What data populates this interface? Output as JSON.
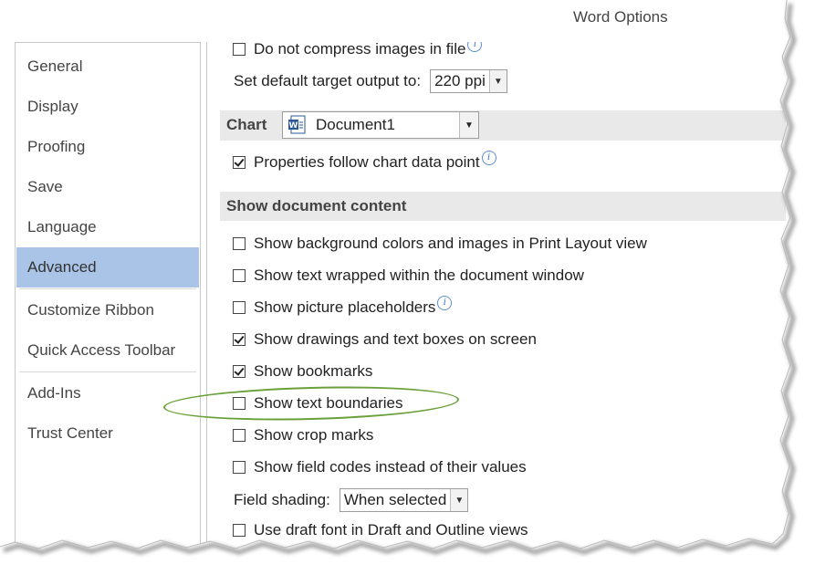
{
  "window": {
    "title": "Word Options"
  },
  "sidebar": {
    "items": [
      {
        "label": "General",
        "active": false
      },
      {
        "label": "Display",
        "active": false
      },
      {
        "label": "Proofing",
        "active": false
      },
      {
        "label": "Save",
        "active": false
      },
      {
        "label": "Language",
        "active": false
      },
      {
        "label": "Advanced",
        "active": true
      },
      {
        "label": "Customize Ribbon",
        "active": false
      },
      {
        "label": "Quick Access Toolbar",
        "active": false
      },
      {
        "label": "Add-Ins",
        "active": false
      },
      {
        "label": "Trust Center",
        "active": false
      }
    ]
  },
  "content": {
    "compress_images": {
      "label": "Do not compress images in file",
      "checked": false
    },
    "target_output": {
      "label": "Set default target output to:",
      "value": "220 ppi"
    },
    "chart": {
      "header": "Chart",
      "document": "Document1"
    },
    "properties_follow": {
      "label": "Properties follow chart data point",
      "checked": true
    },
    "show_doc_content": {
      "header": "Show document content"
    },
    "options": [
      {
        "label": "Show background colors and images in Print Layout view",
        "checked": false
      },
      {
        "label": "Show text wrapped within the document window",
        "checked": false
      },
      {
        "label": "Show picture placeholders",
        "checked": false
      },
      {
        "label": "Show drawings and text boxes on screen",
        "checked": true
      },
      {
        "label": "Show bookmarks",
        "checked": true
      },
      {
        "label": "Show text boundaries",
        "checked": false
      },
      {
        "label": "Show crop marks",
        "checked": false
      },
      {
        "label": "Show field codes instead of their values",
        "checked": false
      }
    ],
    "field_shading": {
      "label": "Field shading:",
      "value": "When selected"
    },
    "draft_font": {
      "label": "Use draft font in Draft and Outline views",
      "checked": false
    }
  },
  "icons": {
    "info": "i",
    "dropdown": "▼"
  },
  "colors": {
    "active_nav": "#a9c4e6",
    "highlight": "#6aa03a",
    "section_bg": "#e9e9e9"
  }
}
